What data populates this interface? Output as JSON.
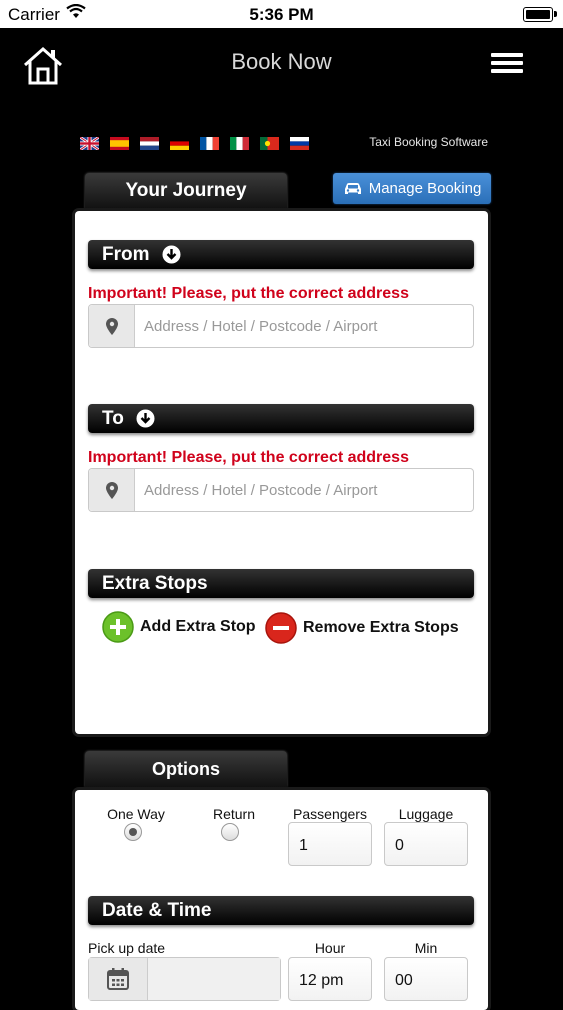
{
  "status": {
    "carrier": "Carrier",
    "time": "5:36 PM"
  },
  "nav": {
    "title": "Book Now"
  },
  "languages": [
    "english-flag",
    "spanish-flag",
    "dutch-flag",
    "german-flag",
    "french-flag",
    "italian-flag",
    "portuguese-flag",
    "russian-flag"
  ],
  "brand": "Taxi Booking Software",
  "journey": {
    "tab": "Your Journey",
    "manage_booking": "Manage Booking",
    "from": {
      "label": "From",
      "warning": "Important! Please, put the correct address",
      "placeholder": "Address / Hotel / Postcode / Airport"
    },
    "to": {
      "label": "To",
      "warning": "Important! Please, put the correct address",
      "placeholder": "Address / Hotel / Postcode / Airport"
    },
    "extra_stops": {
      "label": "Extra Stops",
      "add": "Add Extra Stop",
      "remove": "Remove Extra Stops"
    }
  },
  "options": {
    "tab": "Options",
    "one_way": "One Way",
    "return": "Return",
    "trip_type_selected": "One Way",
    "passengers_label": "Passengers",
    "passengers": "1",
    "luggage_label": "Luggage",
    "luggage": "0"
  },
  "datetime": {
    "label": "Date & Time",
    "pickup_label": "Pick up date",
    "hour_label": "Hour",
    "hour": "12 pm",
    "min_label": "Min",
    "min": "00"
  },
  "colors": {
    "warning": "#d0021b",
    "accent": "#2a6fb8",
    "add": "#6cc12a",
    "remove": "#d9261c"
  }
}
